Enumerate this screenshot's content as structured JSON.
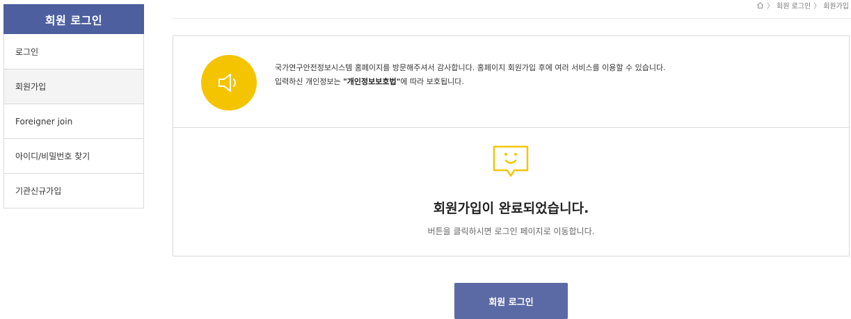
{
  "sidebar": {
    "title": "회원 로그인",
    "items": [
      {
        "label": "로그인"
      },
      {
        "label": "회원가입"
      },
      {
        "label": "Foreigner join"
      },
      {
        "label": "아이디/비밀번호 찾기"
      },
      {
        "label": "기관신규가입"
      }
    ],
    "active_index": 1
  },
  "breadcrumb": {
    "home_icon": "home-icon",
    "items": [
      "회원 로그인",
      "회원가입"
    ]
  },
  "notice": {
    "icon": "speaker-icon",
    "line1": "국가연구안전정보시스템 홈페이지를 방문해주셔서 감사합니다. 홈페이지 회원가입 후에 여러 서비스를 이용할 수 있습니다.",
    "line2_prefix": "입력하신 개인정보는 ",
    "line2_bold": "\"개인정보보호법\"",
    "line2_suffix": "에 따라 보호됩니다."
  },
  "complete": {
    "icon": "smile-speech-bubble-icon",
    "title": "회원가입이 완료되었습니다.",
    "description": "버튼을 클릭하시면 로그인 페이지로 이동합니다."
  },
  "actions": {
    "login_label": "회원 로그인"
  },
  "colors": {
    "primary": "#4d5f9e",
    "button": "#5b6aa5",
    "accent": "#f5c400"
  }
}
